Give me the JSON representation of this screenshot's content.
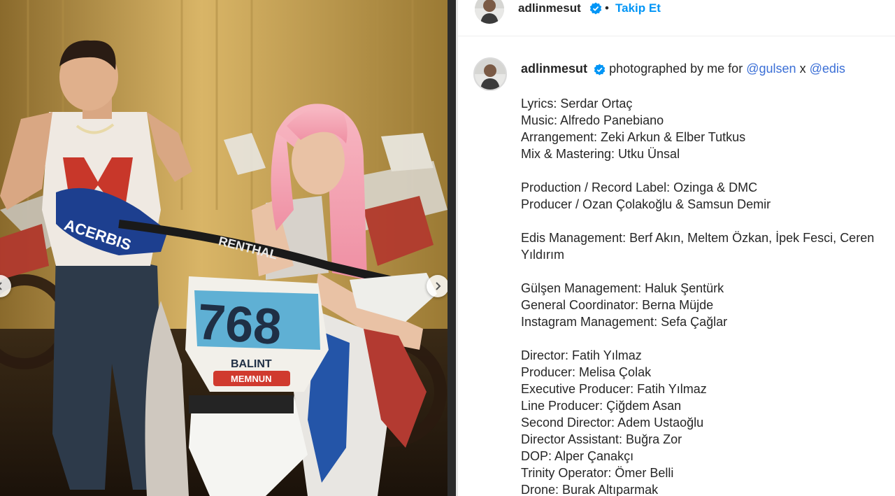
{
  "header": {
    "username": "adlinmesut",
    "separator": "•",
    "follow_label": "Takip Et"
  },
  "caption": {
    "username": "adlinmesut",
    "text_before": "photographed by me for",
    "mention1": "@gulsen",
    "joiner": "x",
    "mention2": "@edis",
    "lines": [
      "Lyrics: Serdar Ortaç",
      "Music: Alfredo Panebiano",
      "Arrangement: Zeki Arkun & Elber Tutkus",
      "Mix & Mastering: Utku Ünsal",
      "",
      "Production / Record Label: Ozinga & DMC",
      "Producer / Ozan Çolakoğlu & Samsun Demir",
      "",
      "Edis Management: Berf Akın, Meltem Özkan, İpek Fesci, Ceren",
      "Yıldırım",
      "",
      "Gülşen Management: Haluk Şentürk",
      "General Coordinator: Berna Müjde",
      "Instagram Management: Sefa Çağlar",
      "",
      "Director: Fatih Yılmaz",
      "Producer: Melisa Çolak",
      "Executive Producer: Fatih Yılmaz",
      "Line Producer: Çiğdem Asan",
      "Second Director: Adem Ustaoğlu",
      "Director Assistant: Buğra Zor",
      "DOP: Alper Çanakçı",
      "Trinity Operator: Ömer Belli",
      "Drone: Burak Altıparmak"
    ]
  },
  "photo": {
    "bike_number": "768",
    "guard_brand": "ACERBIS",
    "handlebar_text": "RENTHAL",
    "fender_text": "BALINT",
    "sticker_text": "MEMNUN",
    "shirt_letter": "M"
  },
  "colors": {
    "link": "#0095f6",
    "mention": "#3b6fd6",
    "verified": "#0095f6",
    "text": "#262626"
  }
}
